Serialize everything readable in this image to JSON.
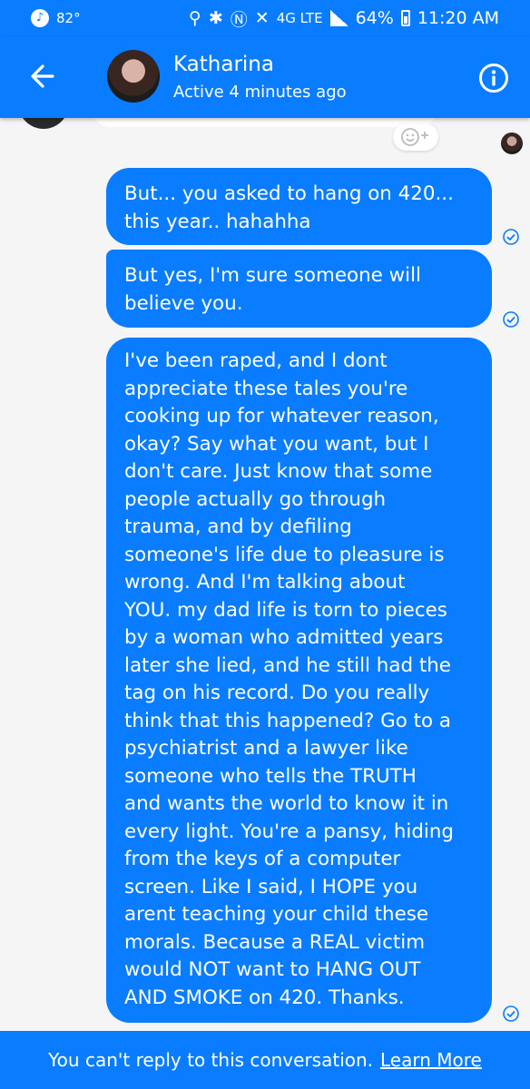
{
  "status_bar": {
    "temperature": "82°",
    "network": "4G LTE",
    "battery": "64%",
    "time": "11:20 AM"
  },
  "header": {
    "contact_name": "Katharina",
    "active_status": "Active 4 minutes ago"
  },
  "messages": [
    {
      "text": "But... you asked to hang on 420...\nthis year.. hahahha"
    },
    {
      "text": "But yes, I'm sure someone will\nbelieve you."
    },
    {
      "text": "I've been raped, and I dont\nappreciate these tales you're\ncooking up for whatever reason,\nokay? Say what you want, but I\ndon't care. Just know that some\npeople actually go through\ntrauma, and by defiling\nsomeone's life due to pleasure is\nwrong. And I'm talking about\nYOU. my dad life is torn to pieces\nby a woman who admitted years\nlater she lied, and he still had the\ntag on his record. Do you really\nthink that this happened? Go to a\npsychiatrist and a lawyer like\nsomeone who tells the TRUTH\nand wants the world to know it in\nevery light. You're a pansy, hiding\nfrom the keys of a computer\nscreen. Like I said, I HOPE you\narent teaching your child these\nmorals. Because a REAL victim\nwould NOT want to HANG OUT\nAND SMOKE on 420. Thanks."
    }
  ],
  "footer": {
    "notice": "You can't reply to this conversation.",
    "link": "Learn More"
  },
  "colors": {
    "accent": "#0a7cff",
    "background": "#f5f5f5"
  },
  "icons": [
    "back-arrow-icon",
    "info-icon",
    "add-reaction-icon",
    "sent-check-icon",
    "clock-icon",
    "location-icon",
    "bluetooth-icon",
    "nfc-icon",
    "mute-icon"
  ]
}
